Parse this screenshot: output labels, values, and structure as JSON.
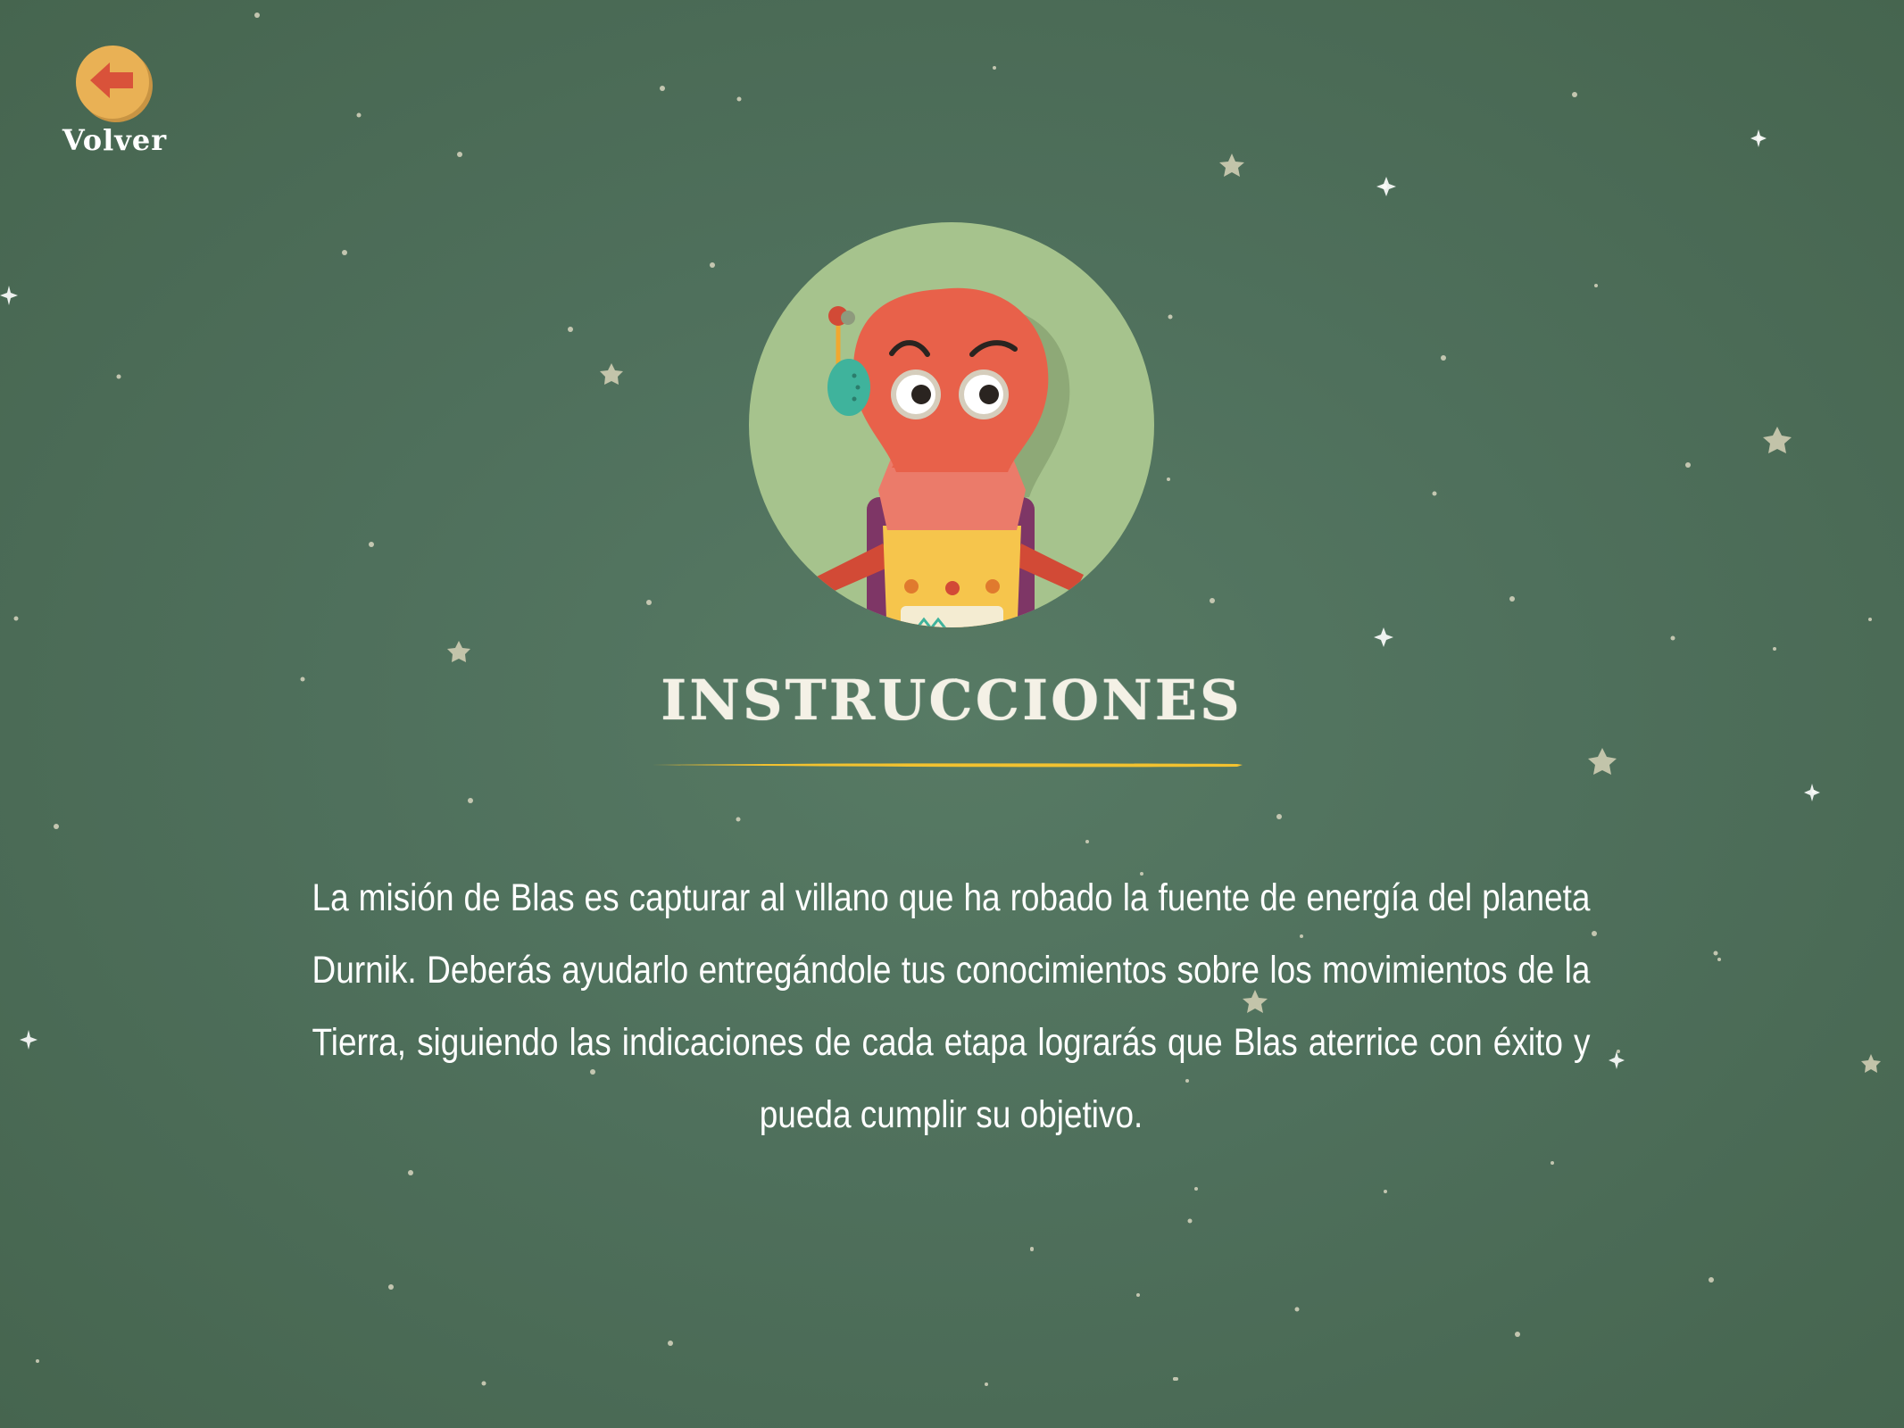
{
  "back_button": {
    "label": "Volver",
    "icon": "arrow-left-icon"
  },
  "character": {
    "name": "blas-robot-avatar"
  },
  "title": "INSTRUCCIONES",
  "instructions_text": "La misión de Blas es capturar al villano que ha robado la fuente de energía del planeta Durnik. Deberás ayudarlo entregándole tus conocimientos sobre los movimientos de la Tierra, siguiendo las indicaciones de cada etapa lograrás que Blas aterrice con éxito y pueda cumplir su objetivo.",
  "colors": {
    "background": "#4f705c",
    "accent": "#f2c230",
    "back_button": "#e9b155",
    "arrow": "#d9523a",
    "avatar_circle": "#a6c38d",
    "robot_head": "#e8614a"
  }
}
